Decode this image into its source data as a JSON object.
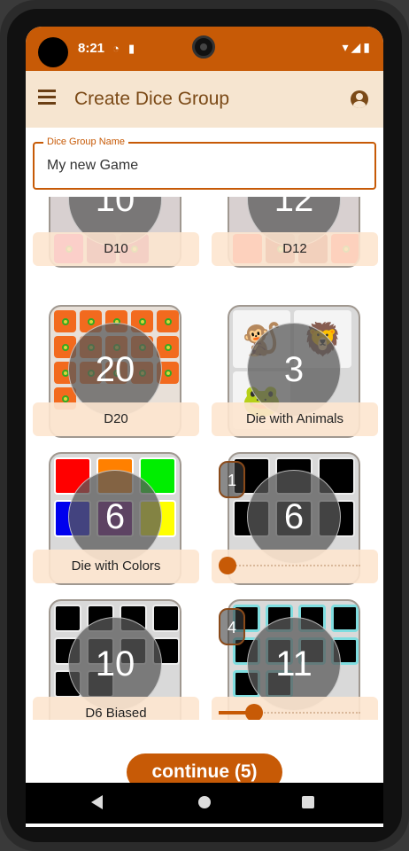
{
  "status_bar": {
    "time": "8:21",
    "left_icons": [
      "settings-sync-icon",
      "sd-card-icon"
    ],
    "right_icons": [
      "wifi-icon",
      "signal-icon",
      "battery-icon"
    ],
    "color": "#c75a06"
  },
  "app_bar": {
    "title": "Create Dice Group",
    "menu_icon": "menu-icon",
    "account_icon": "account-icon",
    "background": "#f6e5d0"
  },
  "name_field": {
    "label": "Dice Group Name",
    "value": "My new Game"
  },
  "dice": [
    {
      "label": "D10",
      "count": "10"
    },
    {
      "label": "D12",
      "count": "12"
    },
    {
      "label": "D20",
      "count": "20"
    },
    {
      "label": "Die with Animals",
      "count": "3"
    },
    {
      "label": "Die with Colors",
      "count": "6"
    },
    {
      "label": "",
      "count": "6",
      "slider_badge": "1",
      "slider_level": 0.0
    },
    {
      "label": "D6 Biased",
      "count": "10"
    },
    {
      "label": "",
      "count": "11",
      "slider_badge": "4",
      "slider_level": 0.2
    }
  ],
  "continue_button": {
    "label": "continue (5)"
  },
  "accent": "#c75a06"
}
